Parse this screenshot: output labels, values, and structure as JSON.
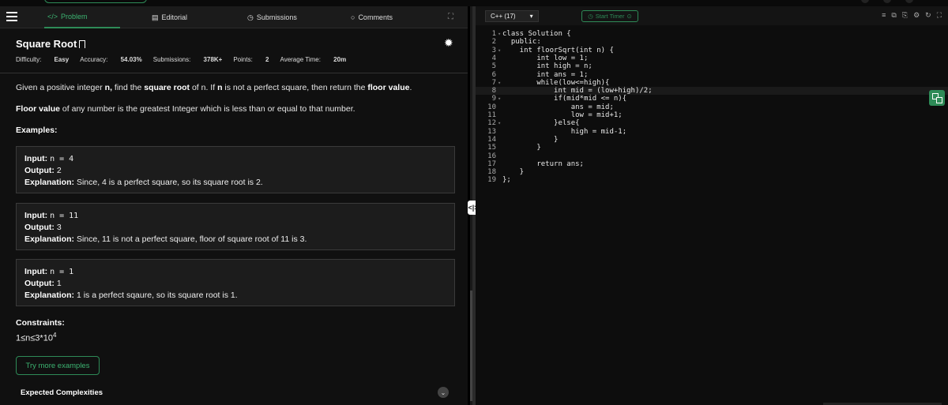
{
  "tabs": [
    {
      "label": "Problem",
      "icon": "code-icon"
    },
    {
      "label": "Editorial",
      "icon": "document-icon"
    },
    {
      "label": "Submissions",
      "icon": "clock-icon"
    },
    {
      "label": "Comments",
      "icon": "comment-icon"
    }
  ],
  "problem": {
    "title": "Square Root",
    "difficulty_label": "Difficulty:",
    "difficulty": "Easy",
    "accuracy_label": "Accuracy:",
    "accuracy": "54.03%",
    "submissions_label": "Submissions:",
    "submissions": "378K+",
    "points_label": "Points:",
    "points": "2",
    "avg_time_label": "Average Time:",
    "avg_time": "20m",
    "desc_p1_a": "Given a positive integer ",
    "desc_p1_b": "n,",
    "desc_p1_c": " find the ",
    "desc_p1_d": "square root",
    "desc_p1_e": " of n. If ",
    "desc_p1_f": "n",
    "desc_p1_g": " is not a perfect square, then return the ",
    "desc_p1_h": "floor value",
    "desc_p1_i": ".",
    "desc_p2_a": "Floor value",
    "desc_p2_b": " of any number is the greatest Integer which is less than or equal to that number.",
    "examples_heading": "Examples:",
    "examples": [
      {
        "input_label": "Input:",
        "input": "n = 4",
        "output_label": "Output:",
        "output": "2",
        "expl_label": "Explanation:",
        "expl": "Since, 4 is a perfect square, so its square root is 2."
      },
      {
        "input_label": "Input:",
        "input": "n = 11",
        "output_label": "Output:",
        "output": "3",
        "expl_label": "Explanation:",
        "expl": "Since, 11 is not a perfect square, floor of square root of 11 is 3."
      },
      {
        "input_label": "Input:",
        "input": "n = 1",
        "output_label": "Output:",
        "output": "1",
        "expl_label": "Explanation:",
        "expl": "1 is a perfect sqaure, so its square root is 1."
      }
    ],
    "constraints_heading": "Constraints:",
    "constraint_base": "1≤n≤3*10",
    "constraint_exp": "4",
    "try_more": "Try more examples",
    "expected": "Expected Complexities"
  },
  "editor": {
    "language": "C++ (17)",
    "timer": "Start Timer",
    "lines": [
      "class Solution {",
      "  public:",
      "    int floorSqrt(int n) {",
      "        int low = 1;",
      "        int high = n;",
      "        int ans = 1;",
      "        while(low<=high){",
      "            int mid = (low+high)/2;",
      "            if(mid*mid <= n){",
      "                ans = mid;",
      "                low = mid+1;",
      "            }else{",
      "                high = mid-1;",
      "            }",
      "        }",
      "",
      "        return ans;",
      "    }",
      "};"
    ],
    "line_numbers": [
      "1",
      "2",
      "3",
      "4",
      "5",
      "6",
      "7",
      "8",
      "9",
      "10",
      "11",
      "12",
      "13",
      "14",
      "15",
      "16",
      "17",
      "18",
      "19"
    ]
  }
}
